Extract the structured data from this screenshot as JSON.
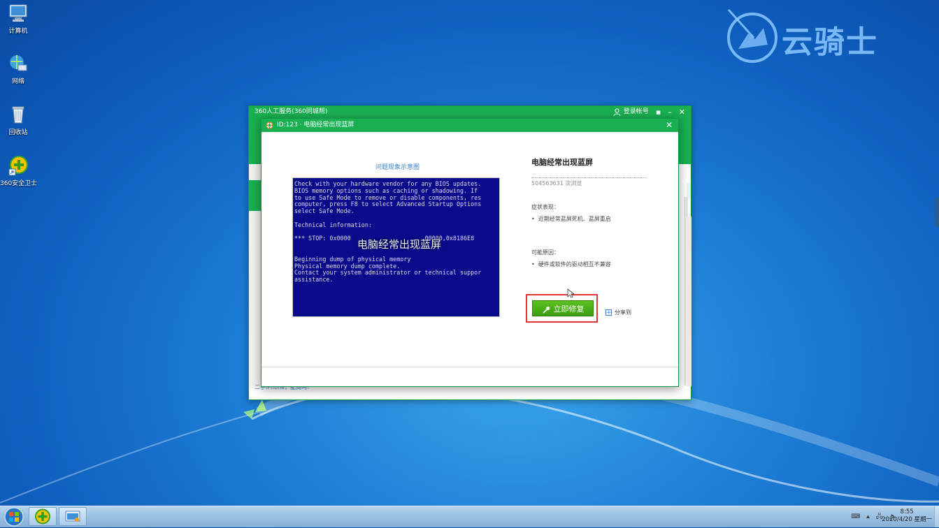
{
  "desktop": {
    "icons": [
      {
        "label": "计算机",
        "icon": "computer-icon"
      },
      {
        "label": "网络",
        "icon": "network-icon"
      },
      {
        "label": "回收站",
        "icon": "recycle-bin-icon"
      },
      {
        "label": "360安全卫士",
        "icon": "360-safeguard-icon"
      }
    ],
    "watermark": "云骑士"
  },
  "outer_window": {
    "title": "360人工服务(360同城帮)",
    "login": "登录帐号",
    "bottom_link": "二手iPhone，能買吗？"
  },
  "dialog": {
    "title": "ID:123 · 电脑经常出现蓝屏",
    "image_caption": "问题现象示意图",
    "bsod_text": "Check with your hardware vendor for any BIOS updates.\nBIOS memory options such as caching or shadowing. If\nto use Safe Mode to remove or disable components, res\ncomputer, press F8 to select Advanced Startup Options\nselect Safe Mode.\n\nTechnical information:\n\n*** STOP: 0x0000                    .00000,0x8186E8\n\n\nBeginning dump of physical memory\nPhysical memory dump complete.\nContact your system administrator or technical suppor\nassistance.",
    "image_overlay": "电脑经常出现蓝屏",
    "problem_title": "电脑经常出现蓝屏",
    "views": "504563631 次浏览",
    "symptom_label": "症状表现：",
    "symptom_item": "近期经常蓝屏死机、蓝屏重启",
    "cause_label": "可能原因：",
    "cause_item": "硬件或软件的驱动相互不兼容",
    "fix_button": "立即修复",
    "share": "分享到"
  },
  "taskbar": {
    "clock_time": "8:55",
    "clock_date": "2020/4/20 星期一"
  },
  "colors": {
    "green": "#1ab052",
    "button_green": "#4aad16",
    "highlight_red": "#e23535",
    "bsod_blue": "#0a0a8a"
  }
}
